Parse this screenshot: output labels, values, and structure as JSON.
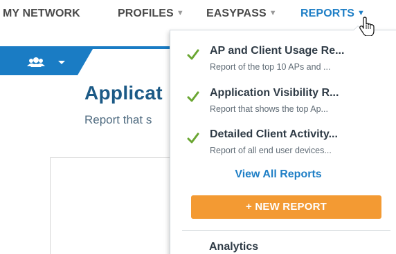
{
  "nav": {
    "my_network": "MY NETWORK",
    "profiles": "PROFILES",
    "easypass": "EASYPASS",
    "reports": "REPORTS"
  },
  "background_page": {
    "title": "Applicat",
    "subtitle": "Report that s"
  },
  "reports_menu": {
    "items": [
      {
        "title": "AP and Client Usage Re...",
        "description": "Report of the top 10 APs and ...",
        "checked": true
      },
      {
        "title": "Application Visibility R...",
        "description": "Report that shows the top Ap...",
        "checked": true
      },
      {
        "title": "Detailed Client Activity...",
        "description": "Report of all end user devices...",
        "checked": true
      }
    ],
    "view_all_label": "View All Reports",
    "new_report_label": "+ NEW REPORT",
    "section_heading": "Analytics"
  },
  "colors": {
    "accent_blue": "#1a7cc4",
    "active_nav": "#1f7fc6",
    "check_green": "#6aa632",
    "button_orange": "#f39a33"
  },
  "icons": {
    "user_group": "users-icon",
    "dropdown_caret": "chevron-down-icon",
    "check": "check-icon",
    "cursor": "hand-pointer-icon"
  }
}
